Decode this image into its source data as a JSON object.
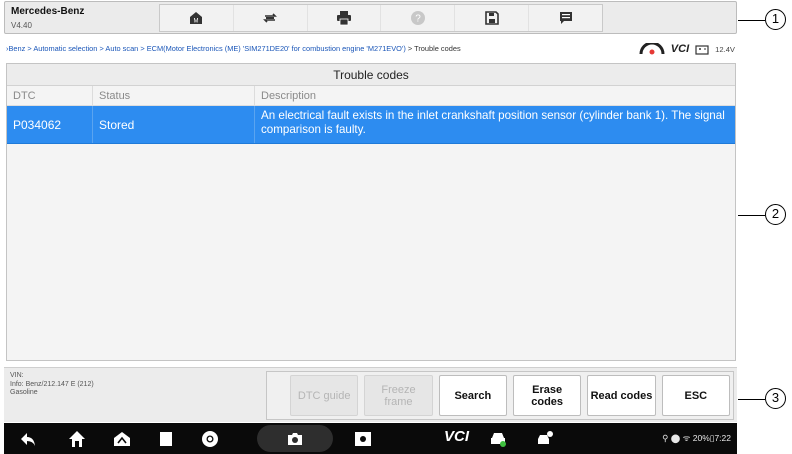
{
  "header": {
    "vehicle_name": "Mercedes-Benz",
    "version": "V4.40",
    "toolbar_icons": [
      "home-icon",
      "vehicle-swap-icon",
      "print-icon",
      "help-icon",
      "save-icon",
      "datalogging-icon"
    ]
  },
  "breadcrumb": {
    "path": "›Benz > Automatic selection > Auto scan > ECM(Motor Electronics (ME) 'SIM271DE20' for combustion engine 'M271EVO')",
    "current": " > Trouble codes",
    "vci_label": "VCI",
    "voltage": "12.4V"
  },
  "panel": {
    "title": "Trouble codes",
    "columns": [
      "DTC",
      "Status",
      "Description"
    ],
    "rows": [
      {
        "dtc": "P034062",
        "status": "Stored",
        "description": "An electrical fault exists in the inlet crankshaft position sensor (cylinder bank 1). The signal comparison is faulty."
      }
    ]
  },
  "info": {
    "vin": "VIN:",
    "line2": "Info: Benz/212.147 E (212)",
    "line3": "Gasoline"
  },
  "function_buttons": [
    {
      "label": "DTC guide",
      "enabled": false
    },
    {
      "label": "Freeze frame",
      "enabled": false
    },
    {
      "label": "Search",
      "enabled": true
    },
    {
      "label": "Erase codes",
      "enabled": true
    },
    {
      "label": "Read codes",
      "enabled": true
    },
    {
      "label": "ESC",
      "enabled": true
    }
  ],
  "navbar": {
    "vci_label": "VCI",
    "status": "⚲ ⬤ ᯤ 20%▯7:22"
  },
  "callouts": [
    "1",
    "2",
    "3"
  ],
  "colors": {
    "selected_row": "#2d8cf0",
    "link": "#1a56b8",
    "navbar": "#0a0a0a"
  }
}
